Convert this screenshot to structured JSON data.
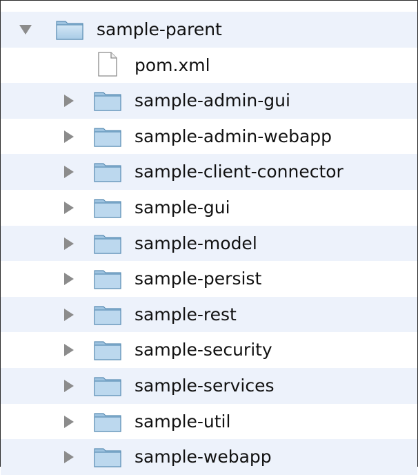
{
  "tree": {
    "root": {
      "label": "sample-parent",
      "type": "folder",
      "expanded": true,
      "icon": "folder-icon"
    },
    "children": [
      {
        "label": "pom.xml",
        "type": "file",
        "icon": "document-icon"
      },
      {
        "label": "sample-admin-gui",
        "type": "folder",
        "expanded": false,
        "icon": "folder-icon"
      },
      {
        "label": "sample-admin-webapp",
        "type": "folder",
        "expanded": false,
        "icon": "folder-icon"
      },
      {
        "label": "sample-client-connector",
        "type": "folder",
        "expanded": false,
        "icon": "folder-icon"
      },
      {
        "label": "sample-gui",
        "type": "folder",
        "expanded": false,
        "icon": "folder-icon"
      },
      {
        "label": "sample-model",
        "type": "folder",
        "expanded": false,
        "icon": "folder-icon"
      },
      {
        "label": "sample-persist",
        "type": "folder",
        "expanded": false,
        "icon": "folder-icon"
      },
      {
        "label": "sample-rest",
        "type": "folder",
        "expanded": false,
        "icon": "folder-icon"
      },
      {
        "label": "sample-security",
        "type": "folder",
        "expanded": false,
        "icon": "folder-icon"
      },
      {
        "label": "sample-services",
        "type": "folder",
        "expanded": false,
        "icon": "folder-icon"
      },
      {
        "label": "sample-util",
        "type": "folder",
        "expanded": false,
        "icon": "folder-icon"
      },
      {
        "label": "sample-webapp",
        "type": "folder",
        "expanded": false,
        "icon": "folder-icon"
      }
    ]
  },
  "colors": {
    "row_alt": "#edf2fb",
    "row_plain": "#ffffff",
    "folder_fill": "#bcd8ee",
    "folder_stroke": "#5d8fb5",
    "disclosure": "#8c8c8c"
  }
}
